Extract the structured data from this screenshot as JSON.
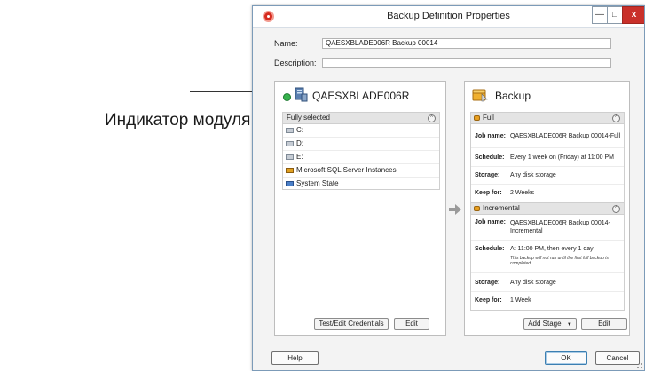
{
  "callout": {
    "text": "Индикатор модуля Упр"
  },
  "window": {
    "title": "Backup Definition Properties",
    "minimize": "—",
    "maximize": "□",
    "close": "x"
  },
  "form": {
    "name_label": "Name:",
    "name_value": "QAESXBLADE006R Backup 00014",
    "description_label": "Description:",
    "description_value": ""
  },
  "source": {
    "server_name": "QAESXBLADE006R",
    "selection_header": "Fully selected",
    "collapse_symbol": "^",
    "items": [
      {
        "label": "C:",
        "icon": "drive-icon"
      },
      {
        "label": "D:",
        "icon": "drive-icon"
      },
      {
        "label": "E:",
        "icon": "drive-icon"
      },
      {
        "label": "Microsoft SQL Server Instances",
        "icon": "sql-server-icon"
      },
      {
        "label": "System State",
        "icon": "system-state-icon"
      }
    ],
    "test_credentials_button": "Test/Edit Credentials",
    "edit_button": "Edit"
  },
  "backup": {
    "title": "Backup",
    "stages": [
      {
        "name": "Full",
        "rows": [
          {
            "key": "Job name:",
            "value": "QAESXBLADE006R Backup 00014-Full"
          },
          {
            "key": "Schedule:",
            "value": "Every 1 week on (Friday) at 11:00 PM"
          },
          {
            "key": "Storage:",
            "value": "Any disk storage"
          },
          {
            "key": "Keep for:",
            "value": "2 Weeks"
          }
        ]
      },
      {
        "name": "Incremental",
        "rows": [
          {
            "key": "Job name:",
            "value": "QAESXBLADE006R Backup 00014-Incremental"
          },
          {
            "key": "Schedule:",
            "value": "At 11:00 PM, then every 1 day",
            "note": "This backup will not run until the first full backup is completed"
          },
          {
            "key": "Storage:",
            "value": "Any disk storage"
          },
          {
            "key": "Keep for:",
            "value": "1 Week"
          }
        ]
      }
    ],
    "add_stage_button": "Add Stage",
    "add_stage_arrow": "▼",
    "edit_button": "Edit"
  },
  "footer": {
    "help_button": "Help",
    "ok_button": "OK",
    "cancel_button": "Cancel"
  },
  "colors": {
    "status_online": "#37b24d",
    "close_button": "#c9302a",
    "app_icon": "#d62b1f"
  }
}
